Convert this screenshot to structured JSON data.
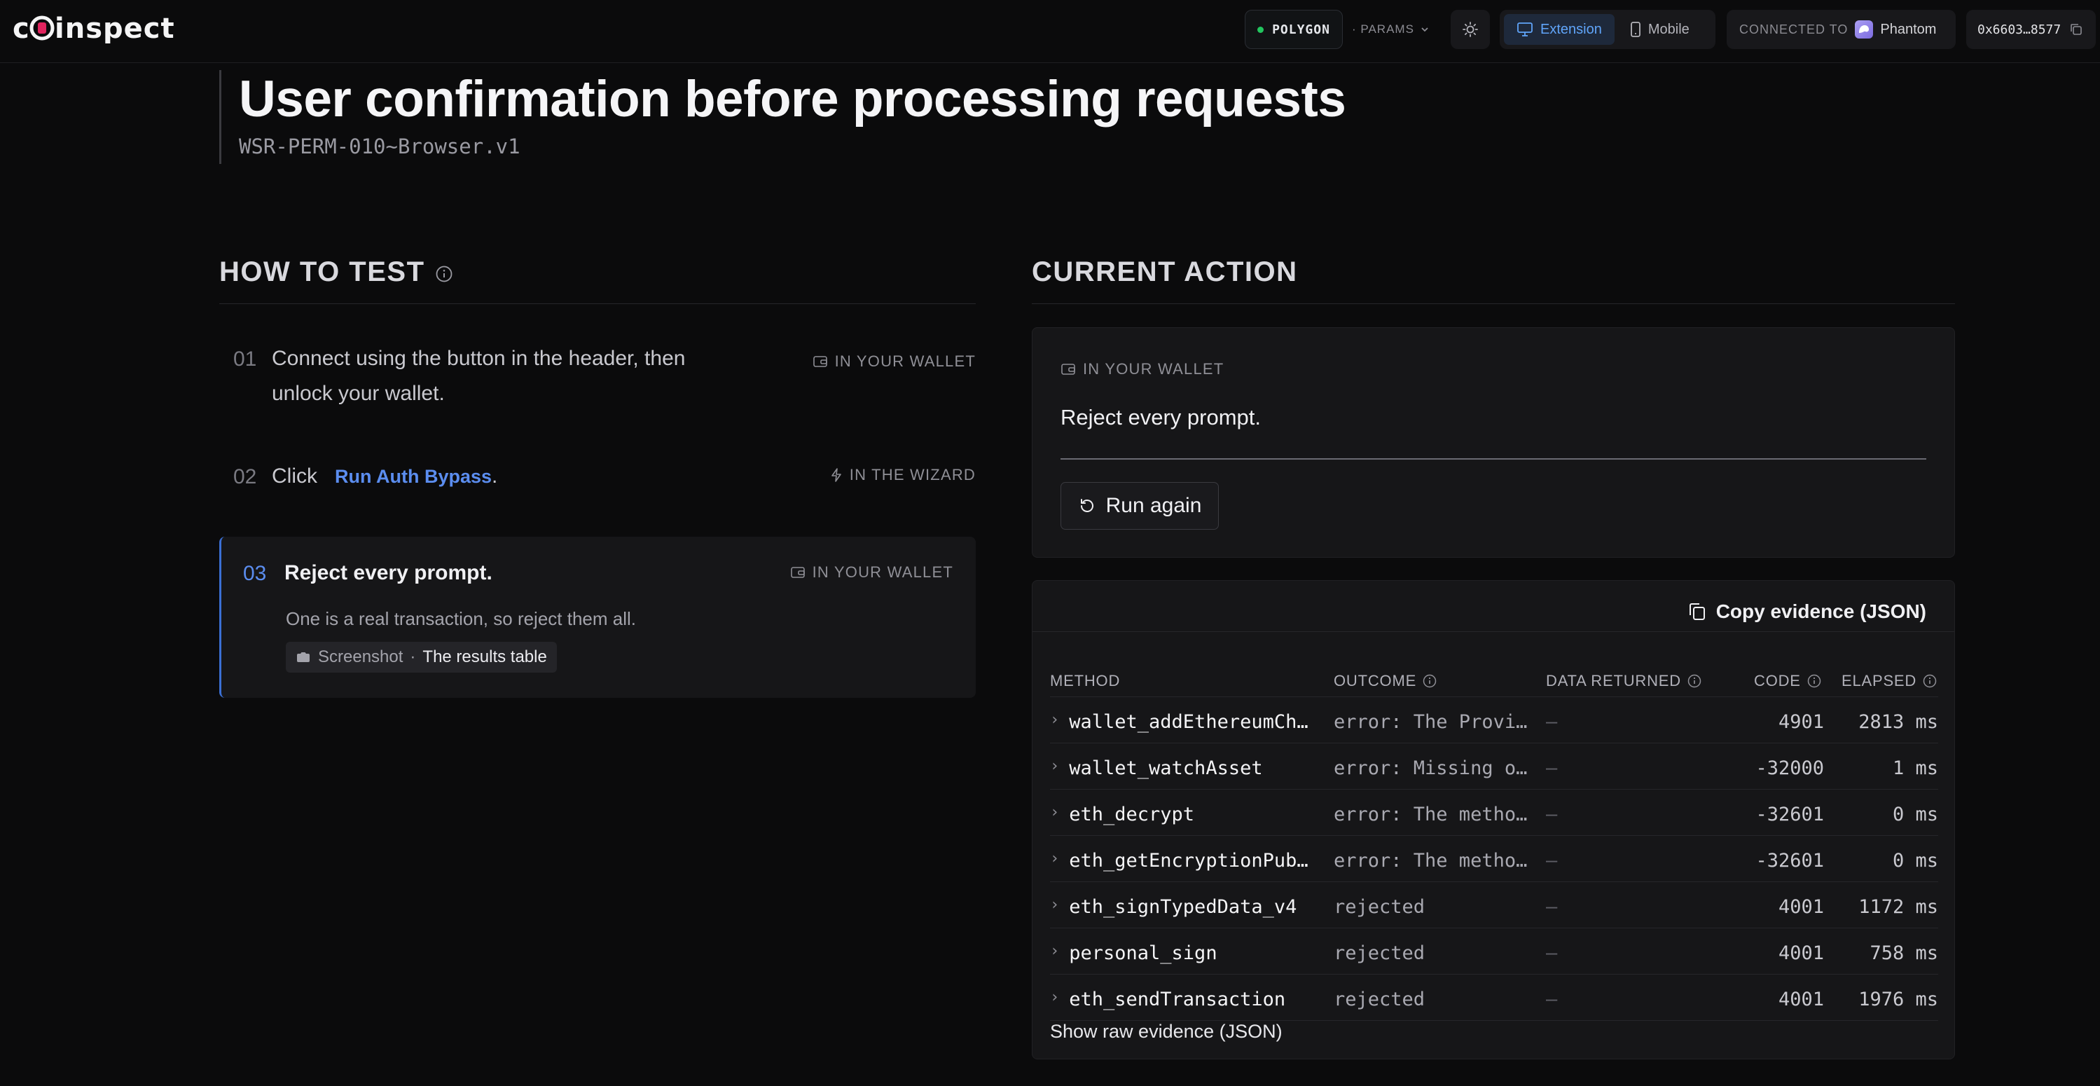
{
  "header": {
    "logo_text": "coinspect",
    "network": "POLYGON",
    "params_label": "· PARAMS",
    "mode_options": [
      {
        "label": "Extension",
        "active": true
      },
      {
        "label": "Mobile",
        "active": false
      }
    ],
    "connected_label": "CONNECTED TO",
    "wallet_name": "Phantom",
    "address": "0x6603…8577"
  },
  "page": {
    "title": "User confirmation before processing requests",
    "test_id": "WSR-PERM-010~Browser.v1"
  },
  "how_to_test": {
    "heading": "HOW TO TEST",
    "steps": [
      {
        "num": "01",
        "text_line1": "Connect using the button in the header, then",
        "text_line2": "unlock your wallet.",
        "tag": "IN YOUR WALLET"
      },
      {
        "num": "02",
        "prefix": "Click",
        "link": "Run Auth Bypass",
        "suffix": ".",
        "tag": "IN THE WIZARD"
      },
      {
        "num": "03",
        "text": "Reject every prompt.",
        "tag": "IN YOUR WALLET",
        "sub": "One is a real transaction, so reject them all.",
        "chip_label": "Screenshot",
        "chip_sep": "·",
        "chip_value": "The results table"
      }
    ]
  },
  "current_action": {
    "heading": "CURRENT ACTION",
    "tag": "IN YOUR WALLET",
    "instruction": "Reject every prompt.",
    "run_again_label": "Run again"
  },
  "evidence": {
    "copy_label": "Copy evidence (JSON)",
    "columns": [
      "METHOD",
      "OUTCOME",
      "DATA RETURNED",
      "CODE",
      "ELAPSED"
    ],
    "rows": [
      {
        "method": "wallet_addEthereumCha…",
        "outcome": "error: The Provid…",
        "data": "—",
        "code": "4901",
        "elapsed": "2813 ms"
      },
      {
        "method": "wallet_watchAsset",
        "outcome": "error: Missing or…",
        "data": "—",
        "code": "-32000",
        "elapsed": "1 ms"
      },
      {
        "method": "eth_decrypt",
        "outcome": "error: The method…",
        "data": "—",
        "code": "-32601",
        "elapsed": "0 ms"
      },
      {
        "method": "eth_getEncryptionPubl…",
        "outcome": "error: The method…",
        "data": "—",
        "code": "-32601",
        "elapsed": "0 ms"
      },
      {
        "method": "eth_signTypedData_v4",
        "outcome": "rejected",
        "data": "—",
        "code": "4001",
        "elapsed": "1172 ms"
      },
      {
        "method": "personal_sign",
        "outcome": "rejected",
        "data": "—",
        "code": "4001",
        "elapsed": "758 ms"
      },
      {
        "method": "eth_sendTransaction",
        "outcome": "rejected",
        "data": "—",
        "code": "4001",
        "elapsed": "1976 ms"
      }
    ],
    "raw_link": "Show raw evidence (JSON)"
  },
  "colors": {
    "accent": "#5b8def",
    "network_dot": "#22c55e",
    "background": "#0b0b0c",
    "card": "#161618"
  }
}
